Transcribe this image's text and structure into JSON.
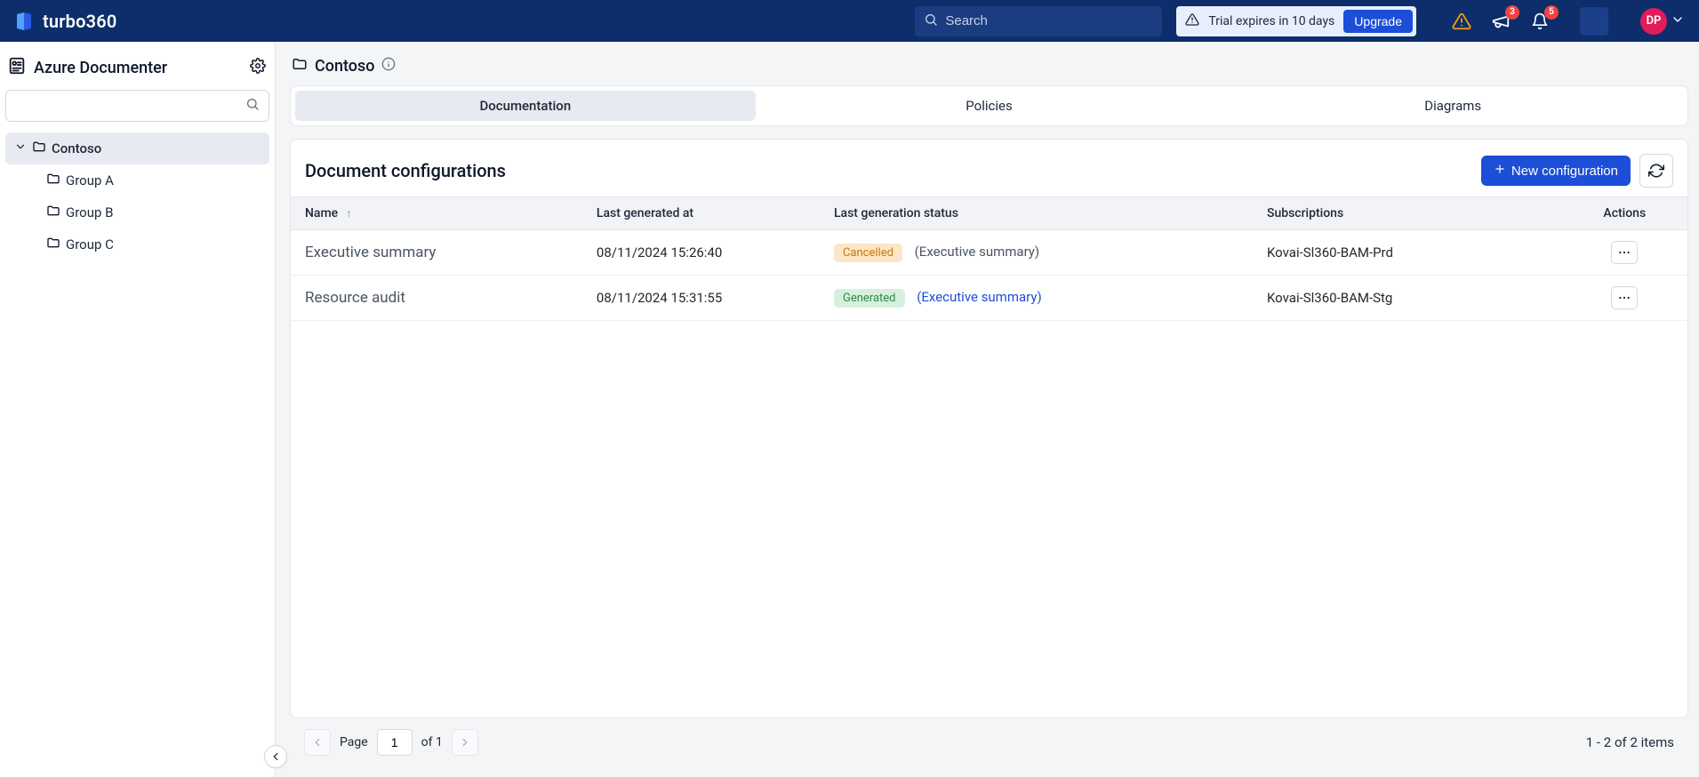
{
  "header": {
    "brand": "turbo360",
    "search_placeholder": "Search",
    "trial_text": "Trial expires in 10 days",
    "upgrade_label": "Upgrade",
    "badge_announcements": "3",
    "badge_notifications": "5",
    "avatar_initials": "DP"
  },
  "sidebar": {
    "title": "Azure Documenter",
    "tree": {
      "root": "Contoso",
      "children": [
        "Group A",
        "Group B",
        "Group C"
      ]
    }
  },
  "breadcrumb": {
    "name": "Contoso"
  },
  "tabs": [
    "Documentation",
    "Policies",
    "Diagrams"
  ],
  "panel": {
    "title": "Document configurations",
    "new_label": "New configuration",
    "columns": {
      "name": "Name",
      "last_gen_at": "Last generated at",
      "last_gen_status": "Last generation status",
      "subscriptions": "Subscriptions",
      "actions": "Actions"
    },
    "rows": [
      {
        "name": "Executive summary",
        "last_gen_at": "08/11/2024 15:26:40",
        "status_pill": "Cancelled",
        "status_pill_class": "cancelled",
        "status_extra": "(Executive summary)",
        "status_extra_kind": "muted",
        "subscription": "Kovai-Sl360-BAM-Prd"
      },
      {
        "name": "Resource audit",
        "last_gen_at": "08/11/2024 15:31:55",
        "status_pill": "Generated",
        "status_pill_class": "generated",
        "status_extra": "(Executive summary)",
        "status_extra_kind": "link",
        "subscription": "Kovai-Sl360-BAM-Stg"
      }
    ]
  },
  "pager": {
    "page_label": "Page",
    "page_value": "1",
    "of_text": "of 1",
    "summary": "1 - 2 of 2 items"
  }
}
